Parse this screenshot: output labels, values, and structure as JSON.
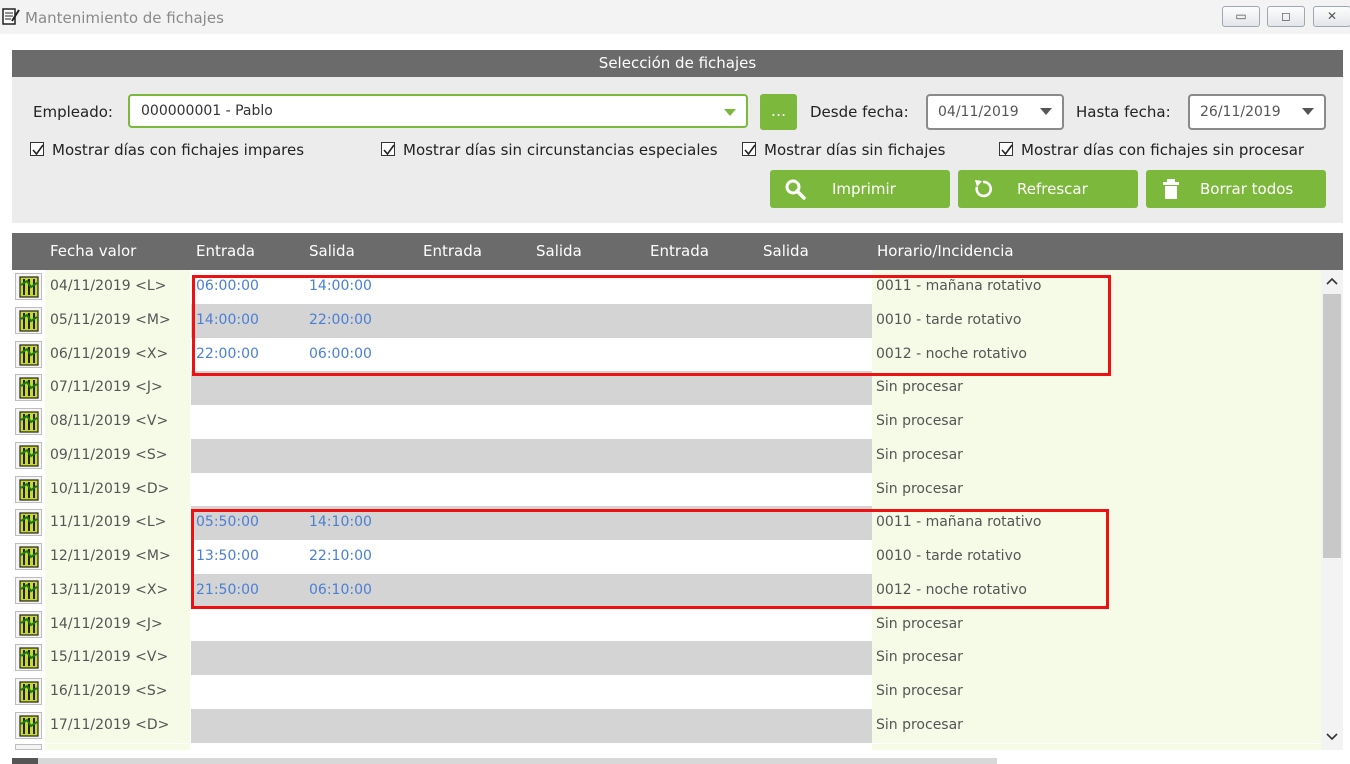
{
  "window": {
    "title": "Mantenimiento de fichajes",
    "buttons": [
      "minimize",
      "restore",
      "close"
    ]
  },
  "selection": {
    "header": "Selección de fichajes",
    "empleado_label": "Empleado:",
    "empleado_value": "000000001 - Pablo",
    "more_label": "...",
    "desde_label": "Desde fecha:",
    "desde_value": "04/11/2019",
    "hasta_label": "Hasta fecha:",
    "hasta_value": "26/11/2019",
    "checkboxes": [
      {
        "label": "Mostrar días con fichajes impares",
        "checked": true
      },
      {
        "label": "Mostrar días sin circunstancias especiales",
        "checked": true
      },
      {
        "label": "Mostrar días sin fichajes",
        "checked": true
      },
      {
        "label": "Mostrar días con fichajes sin procesar",
        "checked": true
      }
    ],
    "actions": {
      "imprimir": "Imprimir",
      "refrescar": "Refrescar",
      "borrar": "Borrar todos"
    }
  },
  "grid": {
    "columns": [
      "Fecha valor",
      "Entrada",
      "Salida",
      "Entrada",
      "Salida",
      "Entrada",
      "Salida",
      "Horario/Incidencia"
    ],
    "rows": [
      {
        "fecha": "04/11/2019 <L>",
        "entrada": "06:00:00",
        "salida": "14:00:00",
        "horario": "0011 - mañana rotativo"
      },
      {
        "fecha": "05/11/2019 <M>",
        "entrada": "14:00:00",
        "salida": "22:00:00",
        "horario": "0010 - tarde rotativo"
      },
      {
        "fecha": "06/11/2019 <X>",
        "entrada": "22:00:00",
        "salida": "06:00:00",
        "horario": "0012 - noche rotativo"
      },
      {
        "fecha": "07/11/2019 <J>",
        "entrada": "",
        "salida": "",
        "horario": "Sin procesar"
      },
      {
        "fecha": "08/11/2019 <V>",
        "entrada": "",
        "salida": "",
        "horario": "Sin procesar"
      },
      {
        "fecha": "09/11/2019 <S>",
        "entrada": "",
        "salida": "",
        "horario": "Sin procesar"
      },
      {
        "fecha": "10/11/2019 <D>",
        "entrada": "",
        "salida": "",
        "horario": "Sin procesar"
      },
      {
        "fecha": "11/11/2019 <L>",
        "entrada": "05:50:00",
        "salida": "14:10:00",
        "horario": "0011 - mañana rotativo"
      },
      {
        "fecha": "12/11/2019 <M>",
        "entrada": "13:50:00",
        "salida": "22:10:00",
        "horario": "0010 - tarde rotativo"
      },
      {
        "fecha": "13/11/2019 <X>",
        "entrada": "21:50:00",
        "salida": "06:10:00",
        "horario": "0012 - noche rotativo"
      },
      {
        "fecha": "14/11/2019 <J>",
        "entrada": "",
        "salida": "",
        "horario": "Sin procesar"
      },
      {
        "fecha": "15/11/2019 <V>",
        "entrada": "",
        "salida": "",
        "horario": "Sin procesar"
      },
      {
        "fecha": "16/11/2019 <S>",
        "entrada": "",
        "salida": "",
        "horario": "Sin procesar"
      },
      {
        "fecha": "17/11/2019 <D>",
        "entrada": "",
        "salida": "",
        "horario": "Sin procesar"
      }
    ]
  },
  "colors": {
    "accent": "#7cb83b",
    "header": "#6b6b6b",
    "highlight": "#ee1111",
    "time": "#4a7fd6"
  }
}
